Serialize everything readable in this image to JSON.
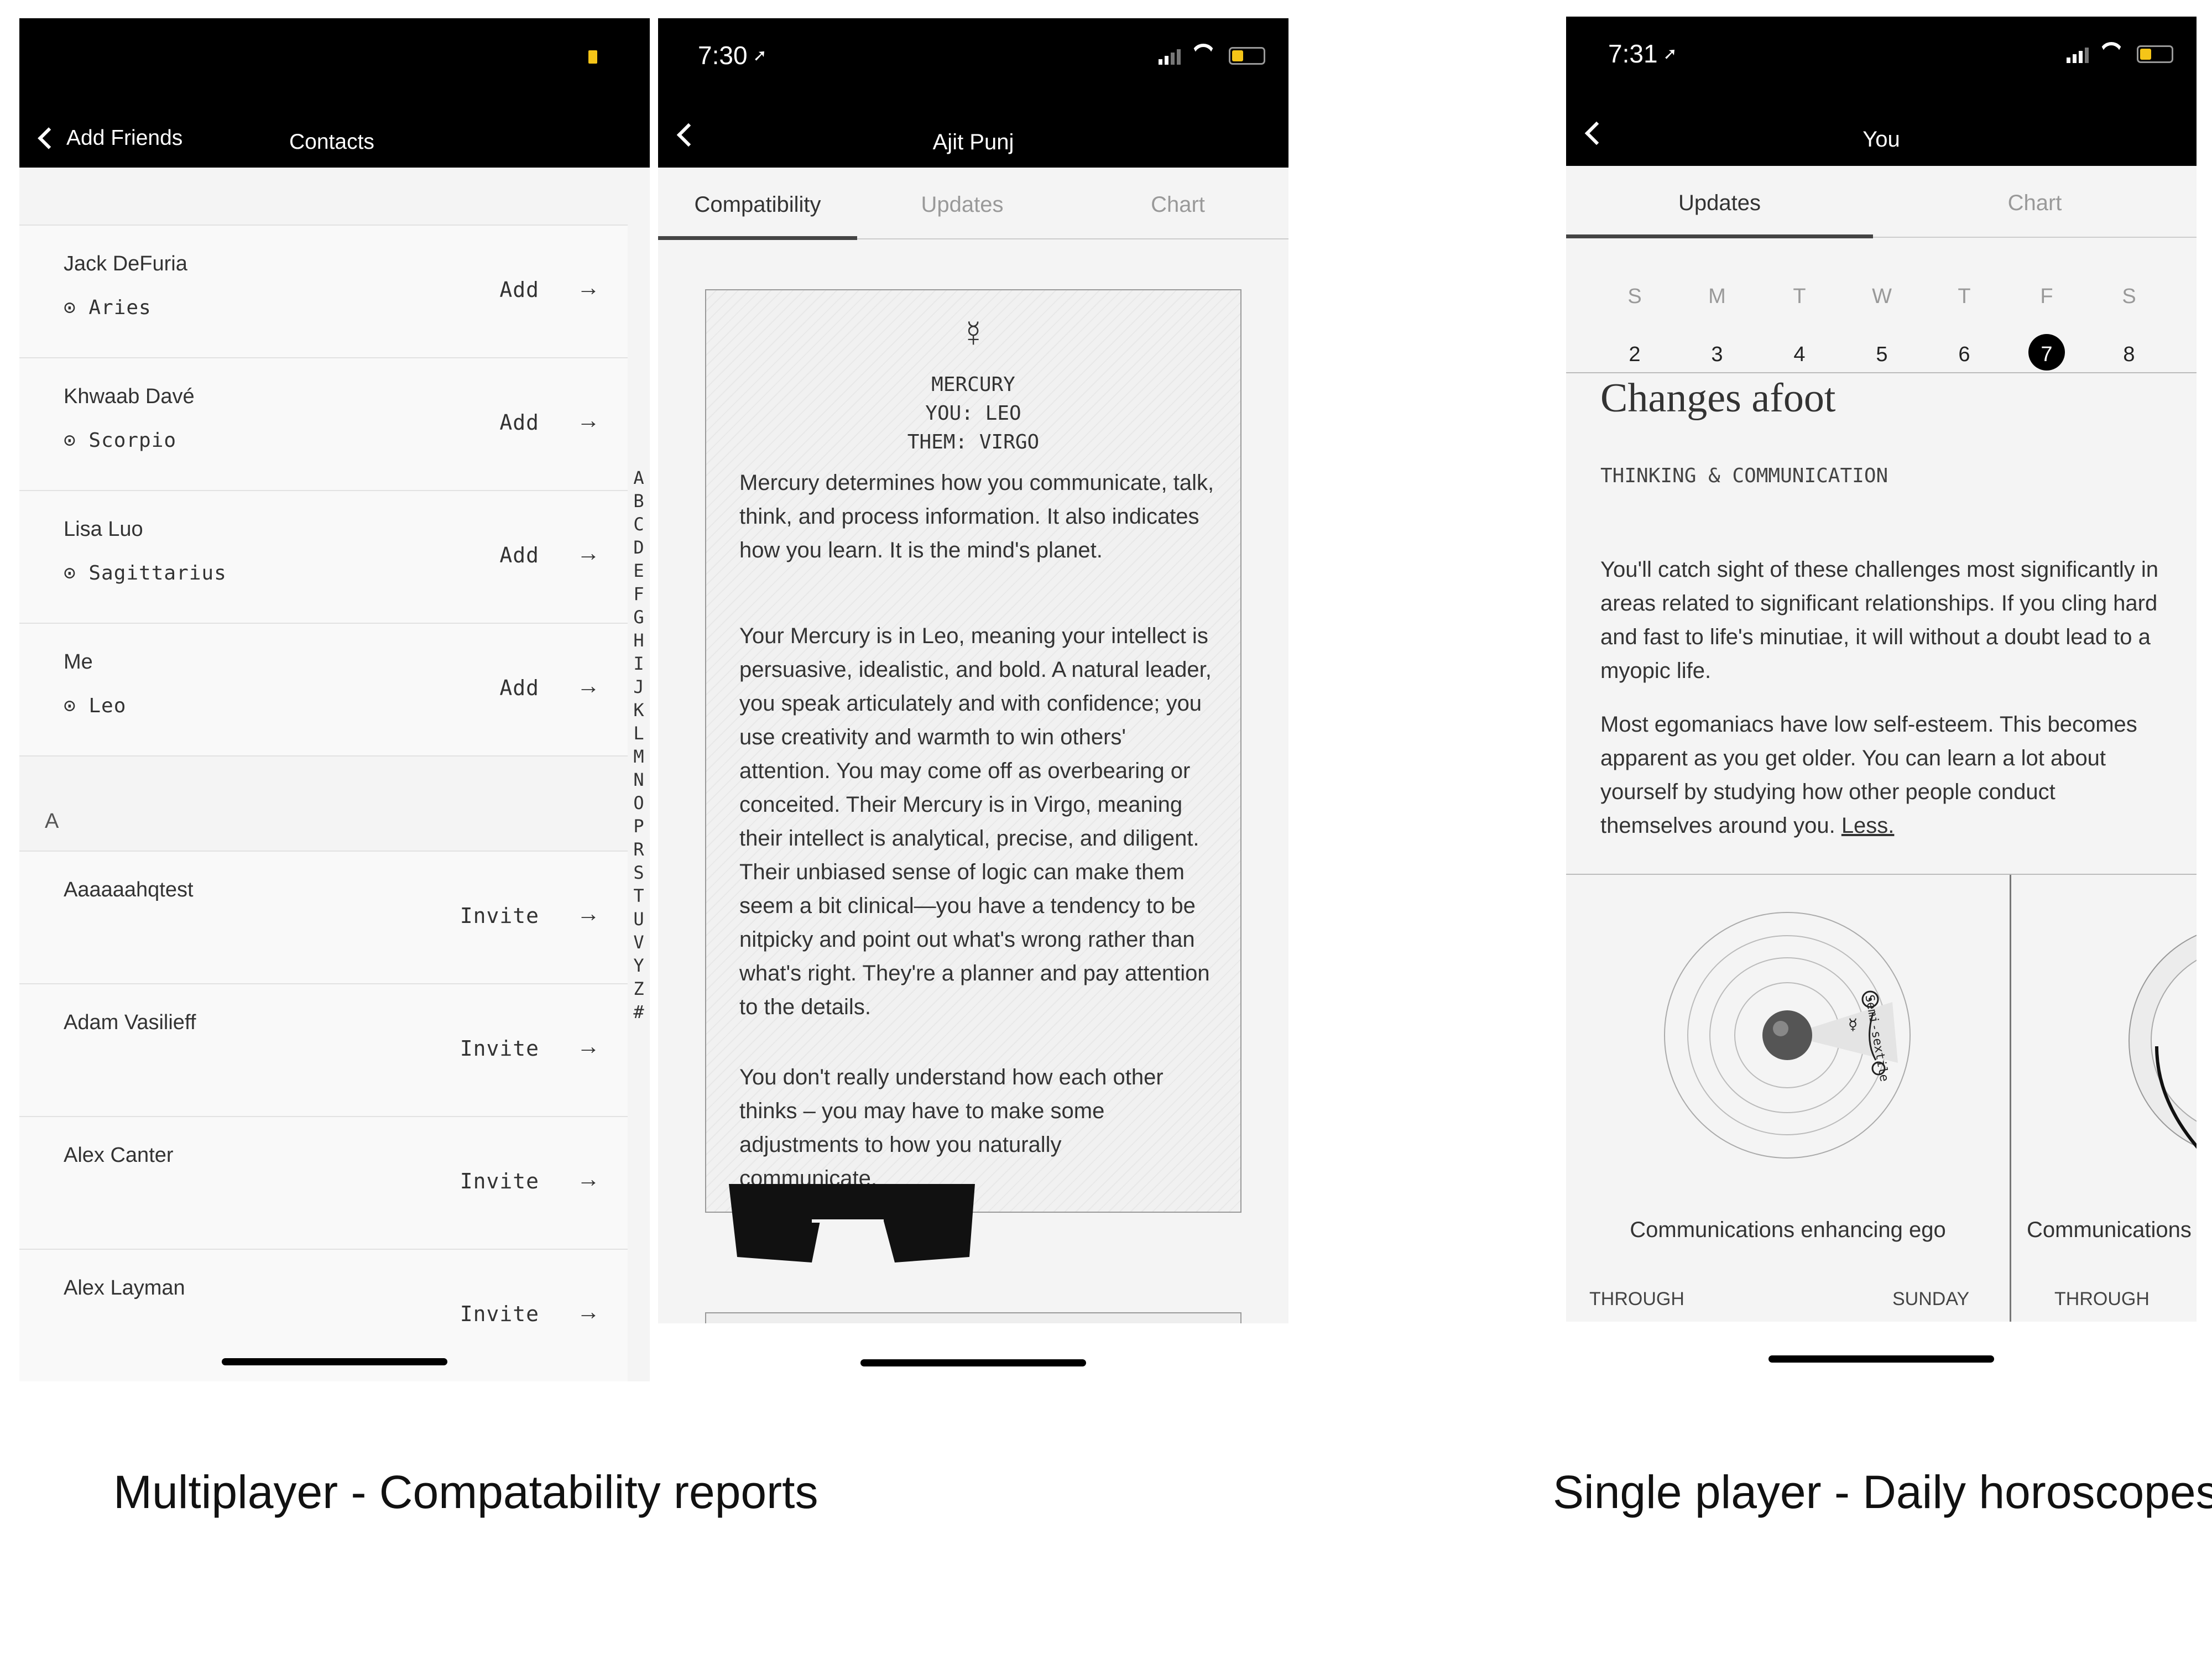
{
  "screen1": {
    "nav_back_label": "Add Friends",
    "nav_title": "Contacts",
    "rows": [
      {
        "name": "Jack DeFuria",
        "sign": "⊙ Aries",
        "action": "Add"
      },
      {
        "name": "Khwaab Davé",
        "sign": "⊙ Scorpio",
        "action": "Add"
      },
      {
        "name": "Lisa Luo",
        "sign": "⊙ Sagittarius",
        "action": "Add"
      },
      {
        "name": "Me",
        "sign": "⊙ Leo",
        "action": "Add"
      }
    ],
    "section_header": "A",
    "invite_rows": [
      {
        "name": "Aaaaaahqtest",
        "action": "Invite"
      },
      {
        "name": "Adam Vasilieff",
        "action": "Invite"
      },
      {
        "name": "Alex Canter",
        "action": "Invite"
      },
      {
        "name": "Alex Layman",
        "action": "Invite"
      }
    ],
    "alphabet": [
      "A",
      "B",
      "C",
      "D",
      "E",
      "F",
      "G",
      "H",
      "I",
      "J",
      "K",
      "L",
      "M",
      "N",
      "O",
      "P",
      "R",
      "S",
      "T",
      "U",
      "V",
      "Y",
      "Z",
      "#"
    ],
    "arrow_glyph": "→"
  },
  "screen2": {
    "time": "7:30",
    "nav_title": "Ajit Punj",
    "tabs": [
      "Compatibility",
      "Updates",
      "Chart"
    ],
    "card": {
      "glyph": "☿",
      "planet": "MERCURY",
      "you": "YOU: LEO",
      "them": "THEM: VIRGO",
      "p1": "Mercury determines how you communicate, talk, think, and process information. It also indicates how you learn. It is the mind's planet.",
      "p2": "Your Mercury is in Leo, meaning your intellect is persuasive, idealistic, and bold. A natural leader, you speak articulately and with confidence; you use creativity and warmth to win others' attention. You may come off as overbearing or conceited. Their Mercury is in Virgo, meaning their intellect is analytical, precise, and diligent. Their unbiased sense of logic can make them seem a bit clinical—you have a tendency to be nitpicky and point out what's wrong rather than what's right. They're a planner and pay attention to the details.",
      "p3": "You don't really understand how each other thinks – you may have to make some adjustments to how you naturally communicate."
    }
  },
  "screen3": {
    "time": "7:31",
    "nav_title": "You",
    "tabs": [
      "Updates",
      "Chart"
    ],
    "weekdays": [
      "S",
      "M",
      "T",
      "W",
      "T",
      "F",
      "S"
    ],
    "dates": [
      "2",
      "3",
      "4",
      "5",
      "6",
      "7",
      "8"
    ],
    "selected_date": "7",
    "heading": "Changes afoot",
    "category": "THINKING & COMMUNICATION",
    "p1": "You'll catch sight of these challenges most significantly in areas related to significant relationships. If you cling hard and fast to life's minutiae, it will without a doubt lead to a myopic life.",
    "p2": "Most egomaniacs have low self-esteem. This becomes apparent as you get older. You can learn a lot about yourself by studying how other people conduct themselves around you.",
    "less_link": "Less.",
    "card1_title": "Communications enhancing ego",
    "card1_through": "THROUGH",
    "card1_day": "SUNDAY",
    "card2_title": "Communications",
    "card2_through": "THROUGH",
    "aspect_label": "Semi-sextile"
  },
  "captions": {
    "left": "Multiplayer - Compatability reports",
    "right": "Single player - Daily horoscopes"
  },
  "colors": {
    "battery_yellow": "#f5c518",
    "black": "#000000",
    "screen_bg": "#f4f4f4"
  }
}
